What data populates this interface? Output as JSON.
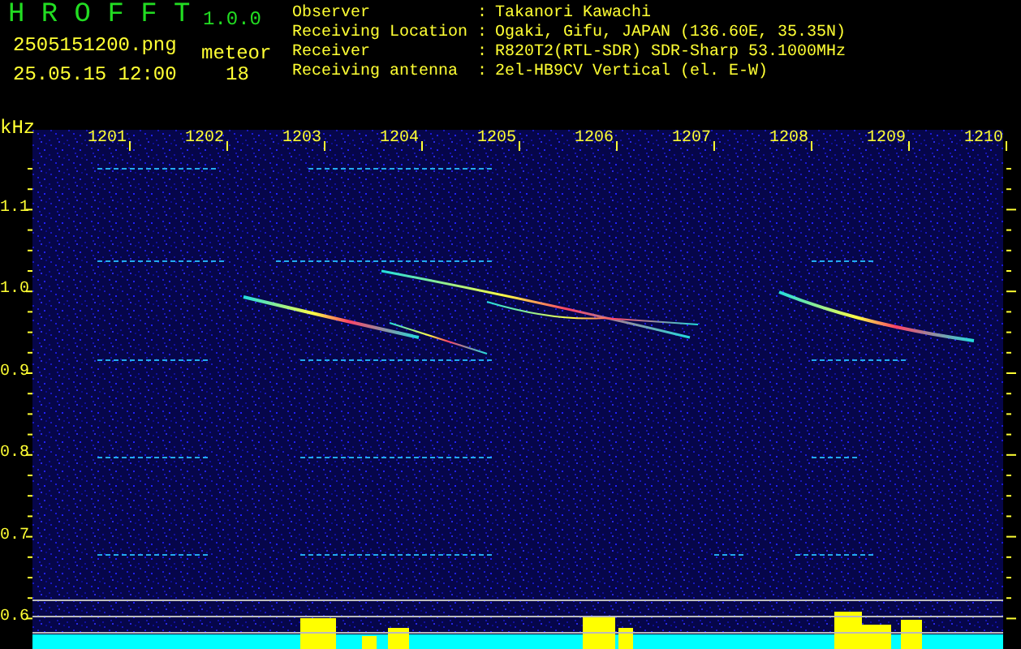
{
  "app": {
    "title": "H R O F F T",
    "version": "1.0.0"
  },
  "file_name": "2505151200.png",
  "timestamp": "25.05.15 12:00",
  "meteor_count": {
    "label": "meteor",
    "value": "18"
  },
  "info": [
    {
      "label": "Observer",
      "separator": ":",
      "value": "Takanori Kawachi"
    },
    {
      "label": "Receiving Location",
      "separator": ":",
      "value": "Ogaki, Gifu, JAPAN (136.60E, 35.35N)"
    },
    {
      "label": "Receiver",
      "separator": ":",
      "value": "R820T2(RTL-SDR) SDR-Sharp 53.1000MHz"
    },
    {
      "label": "Receiving antenna",
      "separator": ":",
      "value": "2el-HB9CV Vertical (el. E-W)"
    }
  ],
  "spectrogram": {
    "y_unit": "kHz",
    "x_labels": [
      "1201",
      "1202",
      "1203",
      "1204",
      "1205",
      "1206",
      "1207",
      "1208",
      "1209",
      "1210"
    ],
    "y_labels": [
      "1.1",
      "1.0",
      "0.9",
      "0.8",
      "0.7",
      "0.6"
    ]
  }
}
